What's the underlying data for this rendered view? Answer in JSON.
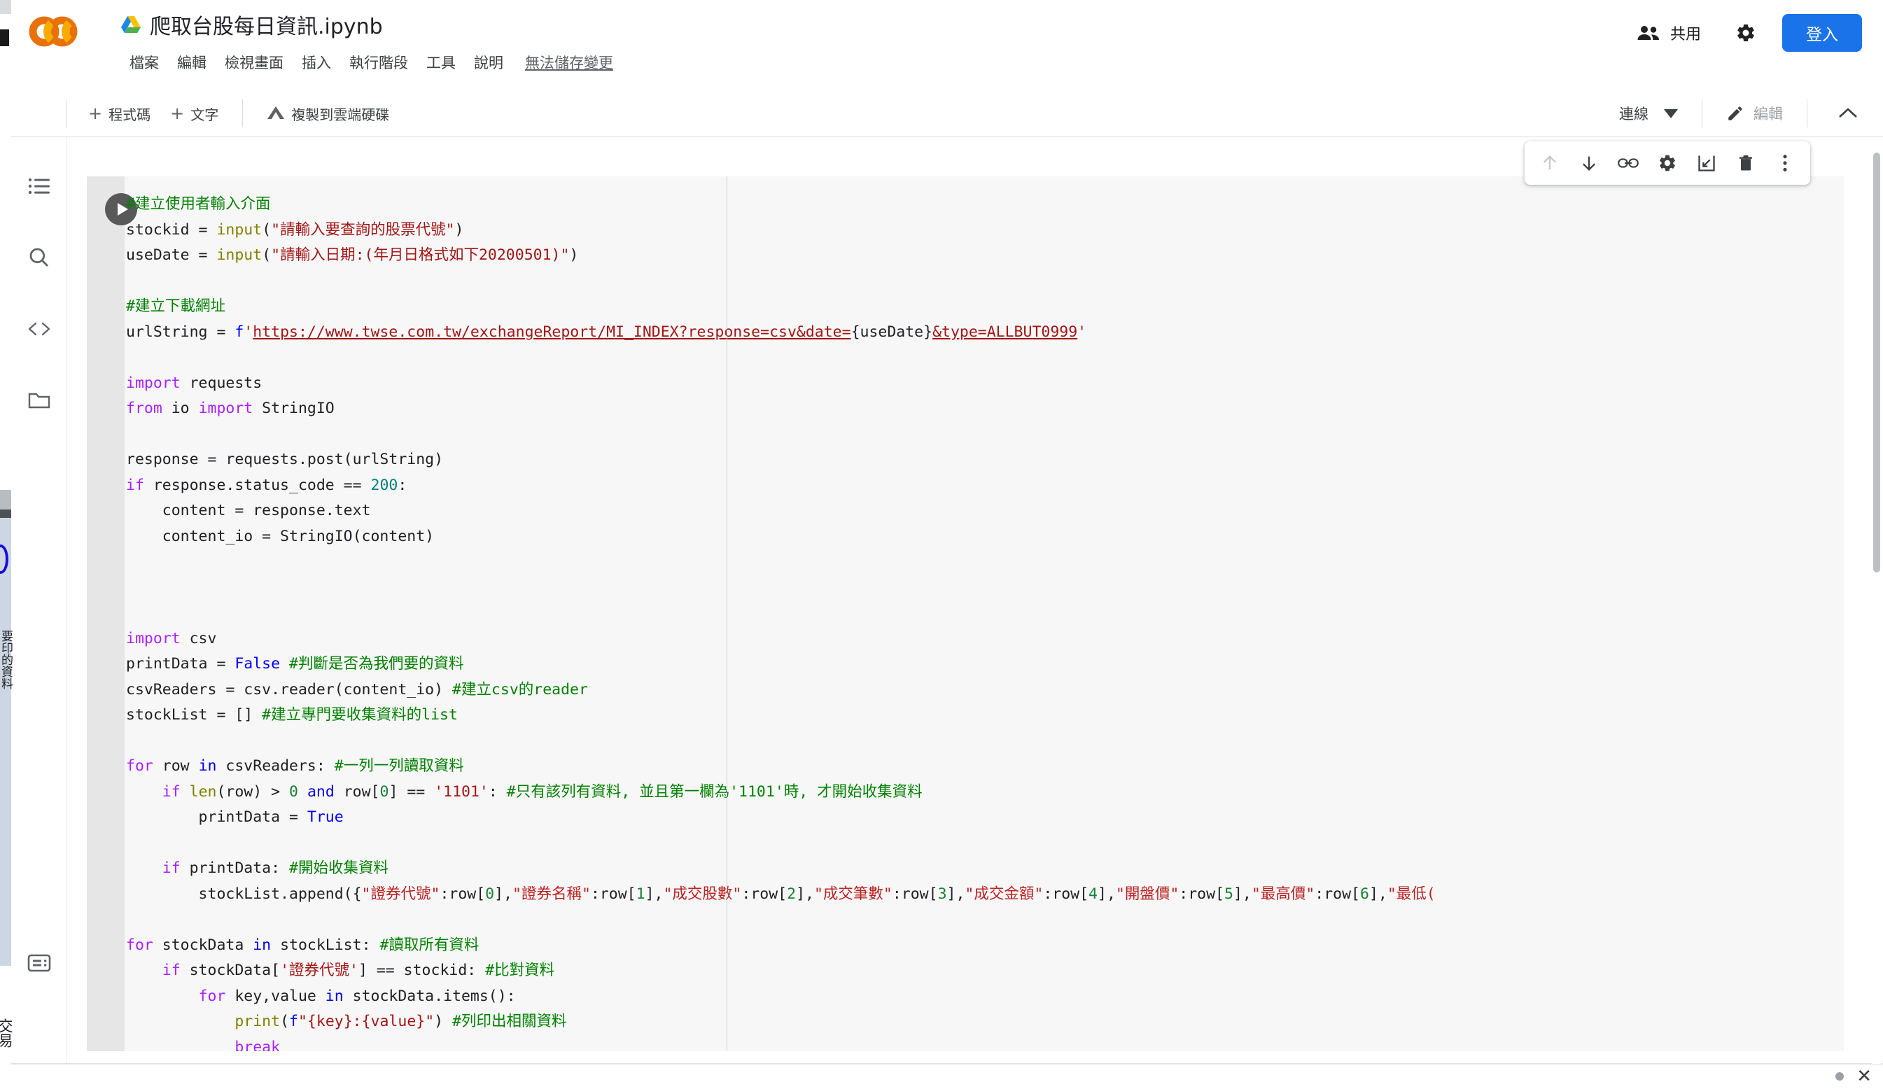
{
  "app": {
    "brand": "CO",
    "logo_colors": {
      "light": "#f9ab00",
      "dark": "#e8710a"
    }
  },
  "header": {
    "doc_title": "爬取台股每日資訊.ipynb",
    "drive_icon": "google-drive-icon",
    "menu": [
      {
        "label": "檔案",
        "name": "menu-file"
      },
      {
        "label": "編輯",
        "name": "menu-edit"
      },
      {
        "label": "檢視畫面",
        "name": "menu-view"
      },
      {
        "label": "插入",
        "name": "menu-insert"
      },
      {
        "label": "執行階段",
        "name": "menu-runtime"
      },
      {
        "label": "工具",
        "name": "menu-tools"
      },
      {
        "label": "說明",
        "name": "menu-help"
      }
    ],
    "save_state": "無法儲存變更",
    "share_label": "共用",
    "share_icon": "people-icon",
    "settings_icon": "gear-icon",
    "signin_label": "登入",
    "accent": "#1a73e8"
  },
  "toolbar": {
    "add_code_label": "程式碼",
    "add_text_label": "文字",
    "add_icon": "plus-icon",
    "copy_to_drive_label": "複製到雲端硬碟",
    "copy_to_drive_icon": "google-drive-icon",
    "connect_label": "連線",
    "connect_caret": "chevron-down-icon",
    "edit_label": "編輯",
    "edit_icon": "pencil-icon",
    "collapse_icon": "chevron-up-icon"
  },
  "sidebar": {
    "items": [
      {
        "name": "sidebar-item-table-of-contents",
        "icon": "list-icon"
      },
      {
        "name": "sidebar-item-search",
        "icon": "search-icon"
      },
      {
        "name": "sidebar-item-code-snippets",
        "icon": "code-brackets-icon"
      },
      {
        "name": "sidebar-item-files",
        "icon": "folder-icon"
      }
    ],
    "bottom_item": {
      "name": "sidebar-item-terminal",
      "icon": "terminal-icon"
    }
  },
  "cell": {
    "run_icon": "play-icon",
    "tools": [
      {
        "name": "move-cell-up-button",
        "icon": "arrow-up-icon",
        "disabled": true
      },
      {
        "name": "move-cell-down-button",
        "icon": "arrow-down-icon",
        "disabled": false
      },
      {
        "name": "copy-cell-link-button",
        "icon": "link-icon",
        "disabled": false
      },
      {
        "name": "cell-settings-button",
        "icon": "gear-icon",
        "disabled": false
      },
      {
        "name": "open-cell-in-new-tab-button",
        "icon": "open-in-new-icon",
        "disabled": false
      },
      {
        "name": "delete-cell-button",
        "icon": "trash-icon",
        "disabled": false
      },
      {
        "name": "more-cell-actions-button",
        "icon": "more-vertical-icon",
        "disabled": false
      }
    ],
    "code_lines": [
      {
        "t": "comment",
        "text": "#建立使用者輸入介面"
      },
      {
        "t": "mixed",
        "segs": [
          [
            "p",
            "stockid = "
          ],
          [
            "fn",
            "input"
          ],
          [
            "p",
            "("
          ],
          [
            "s",
            "\"請輸入要查詢的股票代號\""
          ],
          [
            "p",
            ")"
          ]
        ]
      },
      {
        "t": "mixed",
        "segs": [
          [
            "p",
            "useDate = "
          ],
          [
            "fn",
            "input"
          ],
          [
            "p",
            "("
          ],
          [
            "s",
            "\"請輸入日期:(年月日格式如下20200501)\""
          ],
          [
            "p",
            ")"
          ]
        ]
      },
      {
        "t": "blank",
        "text": ""
      },
      {
        "t": "comment",
        "text": "#建立下載網址"
      },
      {
        "t": "mixed",
        "segs": [
          [
            "p",
            "urlString = "
          ],
          [
            "fp",
            "f"
          ],
          [
            "s",
            "'"
          ],
          [
            "lnk",
            "https://www.twse.com.tw/exchangeReport/MI_INDEX?response=csv&date="
          ],
          [
            "itp",
            "{useDate}"
          ],
          [
            "lnk",
            "&type=ALLBUT0999"
          ],
          [
            "s",
            "'"
          ]
        ]
      },
      {
        "t": "blank",
        "text": ""
      },
      {
        "t": "mixed",
        "segs": [
          [
            "k",
            "import"
          ],
          [
            "p",
            " requests"
          ]
        ]
      },
      {
        "t": "mixed",
        "segs": [
          [
            "k",
            "from"
          ],
          [
            "p",
            " io "
          ],
          [
            "k",
            "import"
          ],
          [
            "p",
            " StringIO"
          ]
        ]
      },
      {
        "t": "blank",
        "text": ""
      },
      {
        "t": "mixed",
        "segs": [
          [
            "p",
            "response = requests.post(urlString)"
          ]
        ]
      },
      {
        "t": "mixed",
        "segs": [
          [
            "k",
            "if"
          ],
          [
            "p",
            " response.status_code == "
          ],
          [
            "n",
            "200"
          ],
          [
            "p",
            ":"
          ]
        ]
      },
      {
        "t": "mixed",
        "segs": [
          [
            "p",
            "    content = response.text"
          ]
        ]
      },
      {
        "t": "mixed",
        "segs": [
          [
            "p",
            "    content_io = StringIO(content)"
          ]
        ]
      },
      {
        "t": "blank",
        "text": ""
      },
      {
        "t": "blank",
        "text": ""
      },
      {
        "t": "blank",
        "text": ""
      },
      {
        "t": "mixed",
        "segs": [
          [
            "k",
            "import"
          ],
          [
            "p",
            " csv"
          ]
        ]
      },
      {
        "t": "mixed",
        "segs": [
          [
            "p",
            "printData = "
          ],
          [
            "bi",
            "False"
          ],
          [
            "p",
            " "
          ],
          [
            "c",
            "#判斷是否為我們要的資料"
          ]
        ]
      },
      {
        "t": "mixed",
        "segs": [
          [
            "p",
            "csvReaders = csv.reader(content_io) "
          ],
          [
            "c",
            "#建立csv的reader"
          ]
        ]
      },
      {
        "t": "mixed",
        "segs": [
          [
            "p",
            "stockList = [] "
          ],
          [
            "c",
            "#建立專門要收集資料的list"
          ]
        ]
      },
      {
        "t": "blank",
        "text": ""
      },
      {
        "t": "mixed",
        "segs": [
          [
            "k",
            "for"
          ],
          [
            "p",
            " row "
          ],
          [
            "ko",
            "in"
          ],
          [
            "p",
            " csvReaders: "
          ],
          [
            "c",
            "#一列一列讀取資料"
          ]
        ]
      },
      {
        "t": "mixed",
        "segs": [
          [
            "p",
            "    "
          ],
          [
            "k",
            "if"
          ],
          [
            "p",
            " "
          ],
          [
            "fn",
            "len"
          ],
          [
            "p",
            "(row) > "
          ],
          [
            "ng",
            "0"
          ],
          [
            "p",
            " "
          ],
          [
            "ko",
            "and"
          ],
          [
            "p",
            " row["
          ],
          [
            "ng",
            "0"
          ],
          [
            "p",
            "] == "
          ],
          [
            "s",
            "'1101'"
          ],
          [
            "p",
            ": "
          ],
          [
            "c",
            "#只有該列有資料, 並且第一欄為'1101'時, 才開始收集資料"
          ]
        ]
      },
      {
        "t": "mixed",
        "segs": [
          [
            "p",
            "        printData = "
          ],
          [
            "bi",
            "True"
          ]
        ]
      },
      {
        "t": "blank",
        "text": ""
      },
      {
        "t": "mixed",
        "segs": [
          [
            "p",
            "    "
          ],
          [
            "k",
            "if"
          ],
          [
            "p",
            " printData: "
          ],
          [
            "c",
            "#開始收集資料"
          ]
        ]
      },
      {
        "t": "mixed",
        "segs": [
          [
            "p",
            "        stockList.append({"
          ],
          [
            "sr",
            "\"證券代號\""
          ],
          [
            "p",
            ":row["
          ],
          [
            "ng",
            "0"
          ],
          [
            "p",
            "],"
          ],
          [
            "sr",
            "\"證券名稱\""
          ],
          [
            "p",
            ":row["
          ],
          [
            "ng",
            "1"
          ],
          [
            "p",
            "],"
          ],
          [
            "sr",
            "\"成交股數\""
          ],
          [
            "p",
            ":row["
          ],
          [
            "ng",
            "2"
          ],
          [
            "p",
            "],"
          ],
          [
            "sr",
            "\"成交筆數\""
          ],
          [
            "p",
            ":row["
          ],
          [
            "ng",
            "3"
          ],
          [
            "p",
            "],"
          ],
          [
            "sr",
            "\"成交金額\""
          ],
          [
            "p",
            ":row["
          ],
          [
            "ng",
            "4"
          ],
          [
            "p",
            "],"
          ],
          [
            "sr",
            "\"開盤價\""
          ],
          [
            "p",
            ":row["
          ],
          [
            "ng",
            "5"
          ],
          [
            "p",
            "],"
          ],
          [
            "sr",
            "\"最高價\""
          ],
          [
            "p",
            ":row["
          ],
          [
            "ng",
            "6"
          ],
          [
            "p",
            "],"
          ],
          [
            "sr",
            "\"最低("
          ]
        ]
      },
      {
        "t": "blank",
        "text": ""
      },
      {
        "t": "mixed",
        "segs": [
          [
            "k",
            "for"
          ],
          [
            "p",
            " stockData "
          ],
          [
            "ko",
            "in"
          ],
          [
            "p",
            " stockList: "
          ],
          [
            "c",
            "#讀取所有資料"
          ]
        ]
      },
      {
        "t": "mixed",
        "segs": [
          [
            "p",
            "    "
          ],
          [
            "k",
            "if"
          ],
          [
            "p",
            " stockData["
          ],
          [
            "s",
            "'證券代號'"
          ],
          [
            "p",
            "] == stockid: "
          ],
          [
            "c",
            "#比對資料"
          ]
        ]
      },
      {
        "t": "mixed",
        "segs": [
          [
            "p",
            "        "
          ],
          [
            "k",
            "for"
          ],
          [
            "p",
            " key,value "
          ],
          [
            "ko",
            "in"
          ],
          [
            "p",
            " stockData.items():"
          ]
        ]
      },
      {
        "t": "mixed",
        "segs": [
          [
            "p",
            "            "
          ],
          [
            "fn",
            "print"
          ],
          [
            "p",
            "("
          ],
          [
            "fp",
            "f"
          ],
          [
            "s",
            "\"{key}:{value}\""
          ],
          [
            "p",
            ") "
          ],
          [
            "c",
            "#列印出相關資料"
          ]
        ]
      },
      {
        "t": "mixed",
        "segs": [
          [
            "p",
            "            "
          ],
          [
            "k",
            "break"
          ]
        ]
      }
    ]
  },
  "statusbar": {
    "dot_icon": "status-dot-icon",
    "close_icon": "close-icon"
  },
  "left_edge": {
    "vertical_text": "要印的資料",
    "vertical_text2": "交易"
  }
}
